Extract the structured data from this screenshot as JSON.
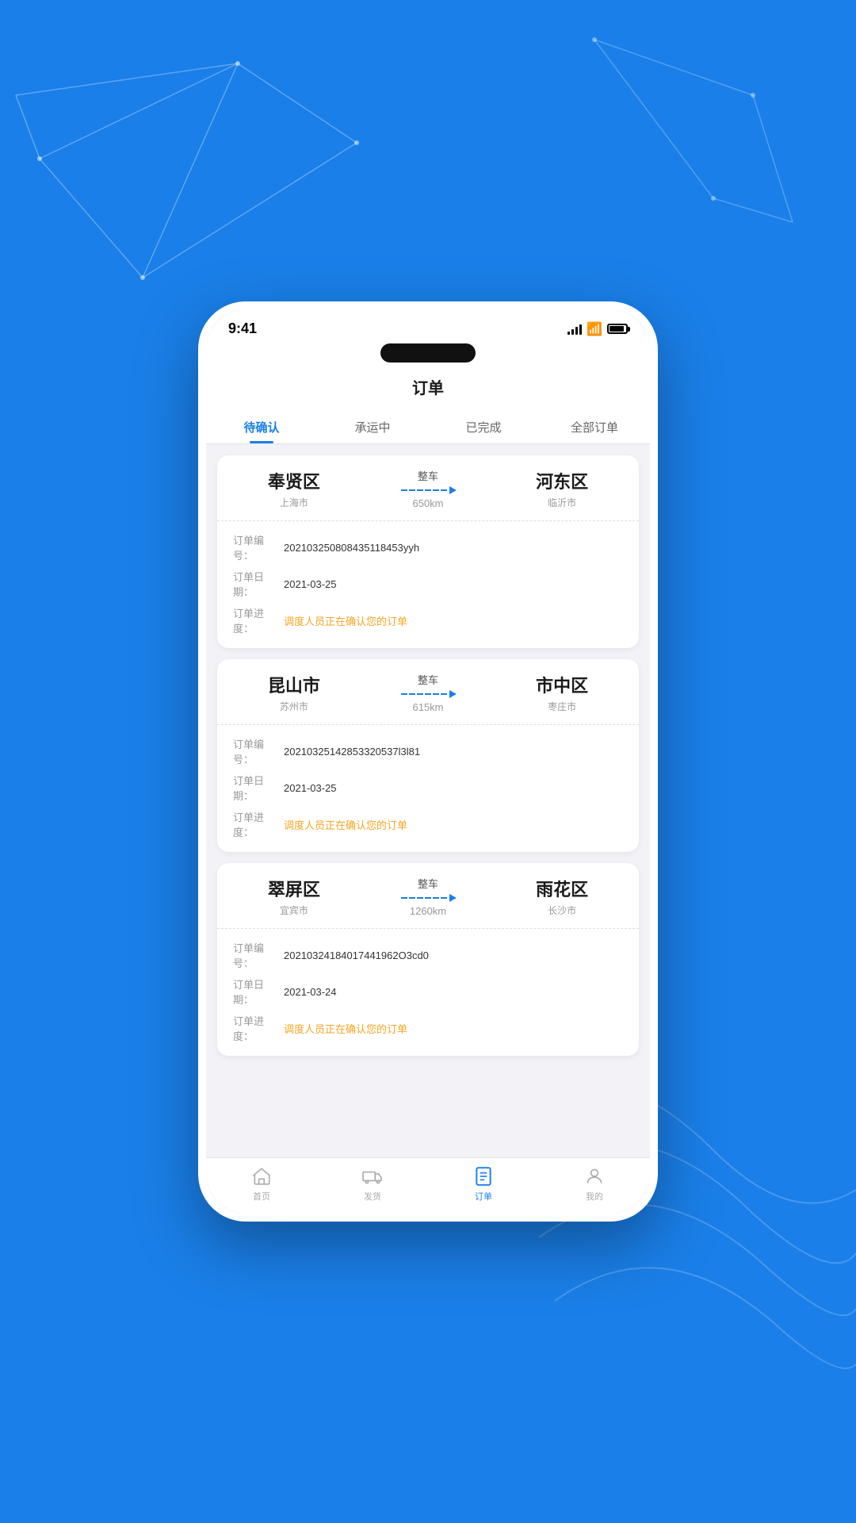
{
  "app": {
    "title": "订单",
    "statusTime": "9:41"
  },
  "tabs": [
    {
      "label": "待确认",
      "active": true
    },
    {
      "label": "承运中",
      "active": false
    },
    {
      "label": "已完成",
      "active": false
    },
    {
      "label": "全部订单",
      "active": false
    }
  ],
  "orders": [
    {
      "from": {
        "city": "奉贤区",
        "sub": "上海市"
      },
      "to": {
        "city": "河东区",
        "sub": "临沂市"
      },
      "type": "整车",
      "distance": "650km",
      "orderNo": {
        "label": "订单编号：",
        "value": "202103250808435118453yyh"
      },
      "orderDate": {
        "label": "订单日期：",
        "value": "2021-03-25"
      },
      "orderProgress": {
        "label": "订单进度：",
        "value": "调度人员正在确认您的订单"
      }
    },
    {
      "from": {
        "city": "昆山市",
        "sub": "苏州市"
      },
      "to": {
        "city": "市中区",
        "sub": "枣庄市"
      },
      "type": "整车",
      "distance": "615km",
      "orderNo": {
        "label": "订单编号：",
        "value": "20210325142853320537l3l81"
      },
      "orderDate": {
        "label": "订单日期：",
        "value": "2021-03-25"
      },
      "orderProgress": {
        "label": "订单进度：",
        "value": "调度人员正在确认您的订单"
      }
    },
    {
      "from": {
        "city": "翠屏区",
        "sub": "宜宾市"
      },
      "to": {
        "city": "雨花区",
        "sub": "长沙市"
      },
      "type": "整车",
      "distance": "1260km",
      "orderNo": {
        "label": "订单编号：",
        "value": "20210324184017441962O3cd0"
      },
      "orderDate": {
        "label": "订单日期：",
        "value": "2021-03-24"
      },
      "orderProgress": {
        "label": "订单进度：",
        "value": "调度人员正在确认您的订单"
      }
    }
  ],
  "bottomNav": [
    {
      "label": "首页",
      "icon": "home",
      "active": false
    },
    {
      "label": "发货",
      "icon": "truck",
      "active": false
    },
    {
      "label": "订单",
      "icon": "order",
      "active": true
    },
    {
      "label": "我的",
      "icon": "user",
      "active": false
    }
  ]
}
